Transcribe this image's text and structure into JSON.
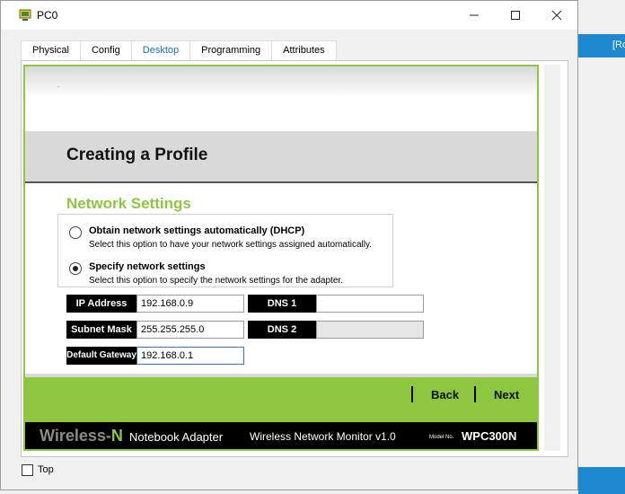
{
  "window": {
    "title": "PC0",
    "background_label": "[Ro"
  },
  "tabs": [
    {
      "label": "Physical"
    },
    {
      "label": "Config"
    },
    {
      "label": "Desktop"
    },
    {
      "label": "Programming"
    },
    {
      "label": "Attributes"
    }
  ],
  "active_tab": "Desktop",
  "app": {
    "page_title": "Creating a Profile",
    "section_title": "Network Settings",
    "options": [
      {
        "title": "Obtain network settings automatically (DHCP)",
        "desc": "Select this option to have your network settings assigned automatically.",
        "checked": false
      },
      {
        "title": "Specify network settings",
        "desc": "Select this option to specify the network settings for the adapter.",
        "checked": true
      }
    ],
    "fields": {
      "ip_label": "IP Address",
      "ip_value": "192.168.0.9",
      "subnet_label": "Subnet Mask",
      "subnet_value": "255.255.255.0",
      "gateway_label": "Default Gateway",
      "gateway_value": "192.168.0.1",
      "dns1_label": "DNS 1",
      "dns1_value": "",
      "dns2_label": "DNS 2",
      "dns2_value": ""
    },
    "nav": {
      "back": "Back",
      "next": "Next"
    },
    "footer": {
      "brand_prefix": "Wireless-",
      "brand_suffix": "N",
      "product": "Notebook Adapter",
      "monitor": "Wireless Network Monitor  v1.0",
      "model_prefix": "Model No.",
      "model": "WPC300N"
    }
  },
  "bottom": {
    "top_label": "Top"
  },
  "colors": {
    "accent_green": "#8dc63f",
    "tab_blue": "#1b6fb5"
  }
}
